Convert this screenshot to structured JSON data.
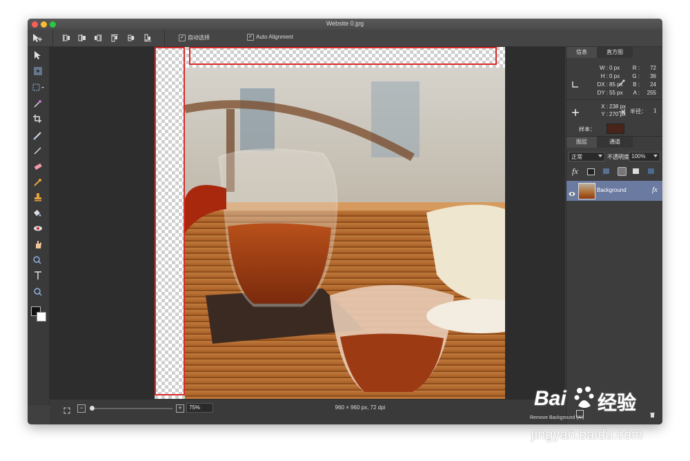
{
  "window": {
    "title": "Website 0.jpg",
    "traffic_colors": [
      "#fc5f57",
      "#fdbc2e",
      "#28c840"
    ]
  },
  "toolbar": {
    "auto_select_label": "自动选择",
    "auto_alignment_label": "Auto Alignment",
    "check_mark": "✓",
    "align_icons": [
      "align-left-icon",
      "align-hcenter-icon",
      "align-right-icon",
      "align-top-icon",
      "align-vcenter-icon",
      "align-bottom-icon"
    ]
  },
  "left_tools": [
    "move-tool-icon",
    "transform-tool-icon",
    "marquee-tool-icon",
    "magic-wand-icon",
    "crop-tool-icon",
    "brush-tool-icon",
    "pencil-tool-icon",
    "eraser-tool-icon",
    "eyedropper-tool-icon",
    "stamp-tool-icon",
    "paint-bucket-icon",
    "red-eye-icon",
    "smudge-tool-icon",
    "zoom-tool-icon",
    "text-tool-icon",
    "magnifier-icon"
  ],
  "info_panel": {
    "tab_info": "信息",
    "tab_histogram": "直方图",
    "w_label": "W :",
    "w_value": "0 px",
    "h_label": "H :",
    "h_value": "0 px",
    "dx_label": "DX :",
    "dx_value": "85 px",
    "dy_label": "DY :",
    "dy_value": "55 px",
    "r_label": "R :",
    "r_value": "72",
    "g_label": "G :",
    "g_value": "36",
    "b_label": "B :",
    "b_value": "24",
    "a_label": "A :",
    "a_value": "255",
    "x_label": "X :",
    "x_value": "238 px",
    "y_label": "Y :",
    "y_value": "270 px",
    "radius_label": "半径：",
    "radius_value": "1",
    "sample_label": "样本：",
    "sample_color": "#48241a"
  },
  "layers_panel": {
    "tab_layers": "图层",
    "tab_channels": "通道",
    "blend_mode": "正常",
    "opacity_label": "不透明度",
    "opacity_value": "100%",
    "fx_label": "fx",
    "layer_name": "Background",
    "layer_fx": "fx"
  },
  "status": {
    "zoom_value": "75%",
    "doc_info": "960 × 960 px, 72 dpi",
    "remove_bg_text": "Remove Background (AI)"
  },
  "watermark": {
    "brand_left": "Bai",
    "brand_right": "经验",
    "url": "jingyan.baidu.com"
  }
}
